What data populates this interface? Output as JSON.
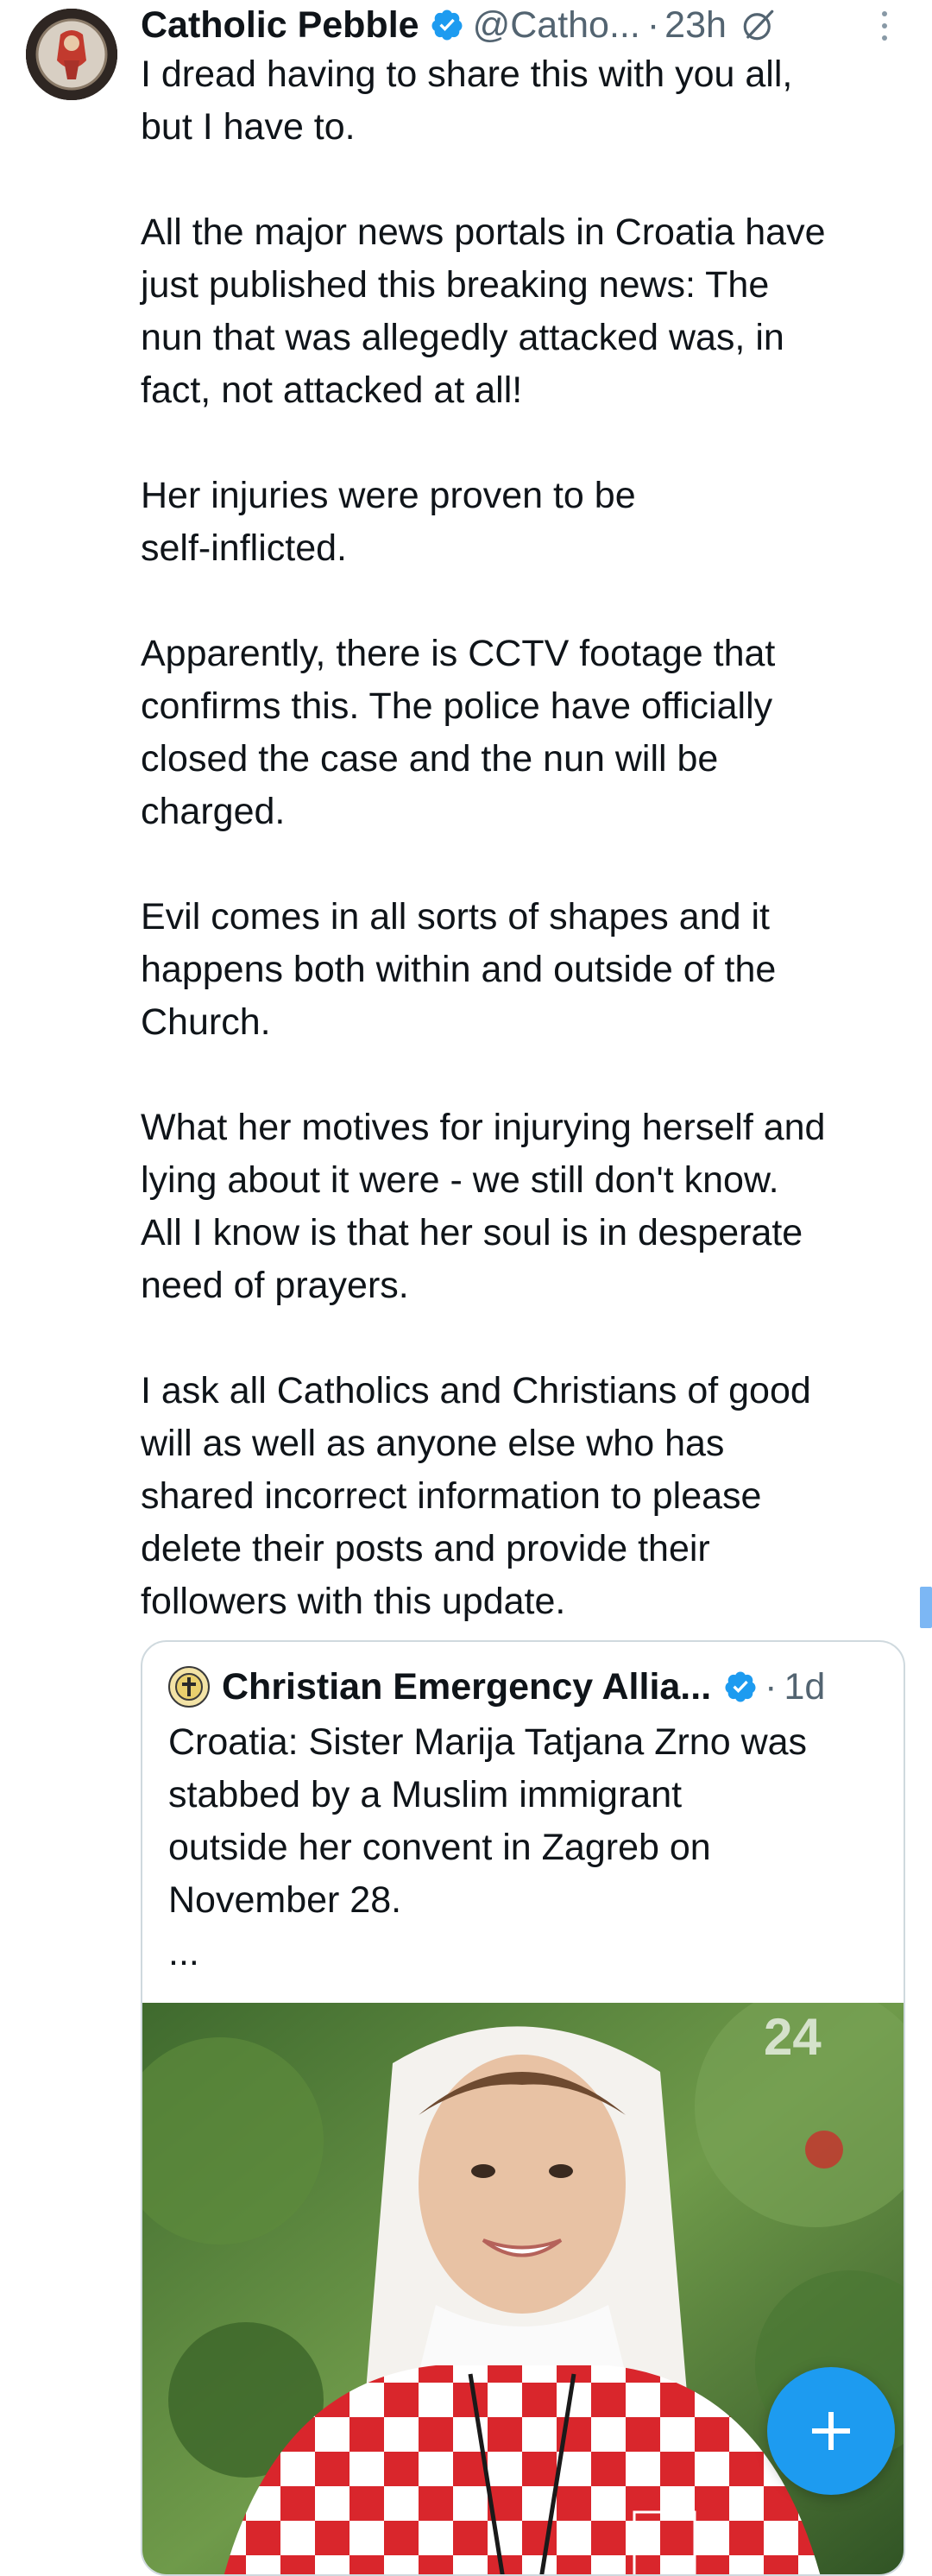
{
  "tweet": {
    "author_name": "Catholic Pebble",
    "author_handle": "@Catho...",
    "separator": "·",
    "time": "23h",
    "paragraphs": [
      "I dread having to share this with you all,\nbut I have to.",
      "All the major news portals in Croatia have\njust published this breaking news: The\nnun that was allegedly attacked was, in\nfact, not attacked at all!",
      "Her injuries were proven to be\nself-inflicted.",
      "Apparently, there is CCTV footage that\nconfirms this. The police have officially\nclosed the case and the nun will be\ncharged.",
      "Evil comes in all sorts of shapes and it\nhappens both within and outside of the\nChurch.",
      "What her motives for injurying herself and\nlying about it were - we still don't know.\nAll I know is that her soul is in desperate\nneed of prayers.",
      "I ask all Catholics and Christians of good\nwill as well as anyone else who has\nshared incorrect information to please\ndelete their posts and provide their\nfollowers with this update."
    ]
  },
  "quoted": {
    "author_name": "Christian Emergency Allia...",
    "separator": "·",
    "time": "1d",
    "text": "Croatia: Sister Marija Tatjana Zrno was\nstabbed by a Muslim immigrant\noutside her convent in Zagreb on\nNovember 28.",
    "ellipsis": "...",
    "media_watermark": "24"
  },
  "icons": {
    "verified": "verified-badge-icon",
    "grok": "grok-icon",
    "more": "more-vertical-icon",
    "compose": "plus-icon"
  },
  "colors": {
    "accent": "#1d9bf0",
    "text": "#0f1419",
    "secondary_text": "#536471",
    "border": "#cfd9de"
  }
}
